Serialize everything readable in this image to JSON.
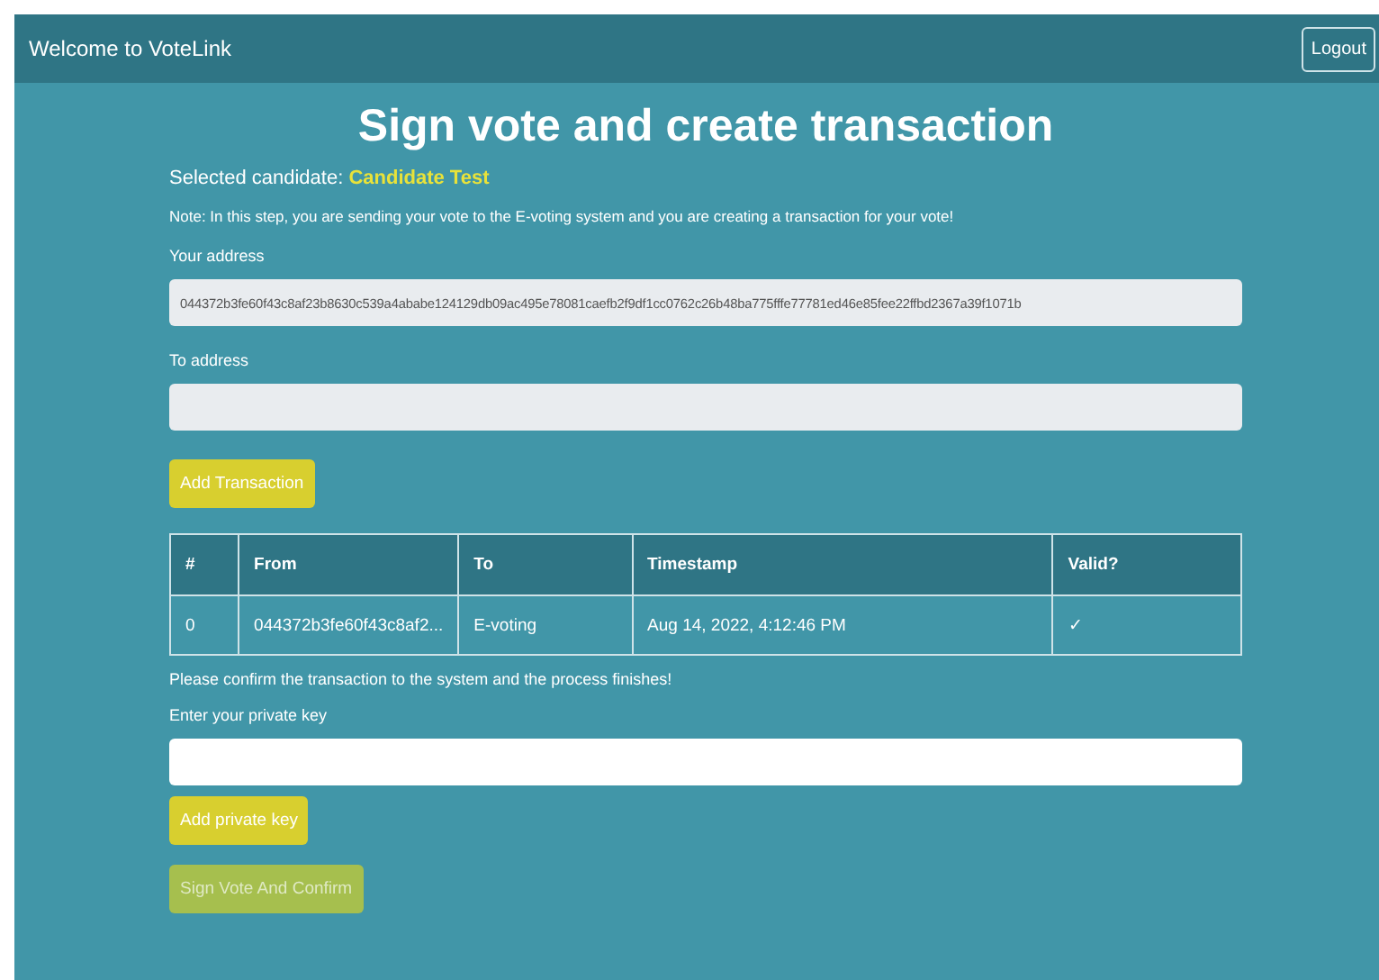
{
  "header": {
    "brand": "Welcome to VoteLink",
    "logout": "Logout"
  },
  "title": "Sign vote and create transaction",
  "candidate": {
    "label": "Selected candidate:",
    "name": "Candidate Test"
  },
  "note": "Note: In this step, you are sending your vote to the E-voting system and you are creating a transaction for your vote!",
  "your_address": {
    "label": "Your address",
    "value": "044372b3fe60f43c8af23b8630c539a4ababe124129db09ac495e78081caefb2f9df1cc0762c26b48ba775fffe77781ed46e85fee22ffbd2367a39f1071b",
    "disabled": true
  },
  "to_address": {
    "label": "To address",
    "disabled": true
  },
  "add_transaction": {
    "label": "Add Transaction",
    "disabled": false
  },
  "table": {
    "columns": [
      "#",
      "From",
      "To",
      "Timestamp",
      "Valid?"
    ],
    "rows": [
      {
        "cells": [
          "0",
          "044372b3fe60f43c8af2...",
          "E-voting",
          "Aug 14, 2022, 4:12:46 PM",
          "✓"
        ]
      }
    ]
  },
  "confirm_text": "Please confirm the transaction to the system and the process finishes!",
  "private_key": {
    "label": "Enter your private key",
    "disabled": false
  },
  "add_key": {
    "label": "Add private key",
    "disabled": false
  },
  "sign": {
    "label": "Sign Vote And Confirm",
    "disabled": true
  }
}
